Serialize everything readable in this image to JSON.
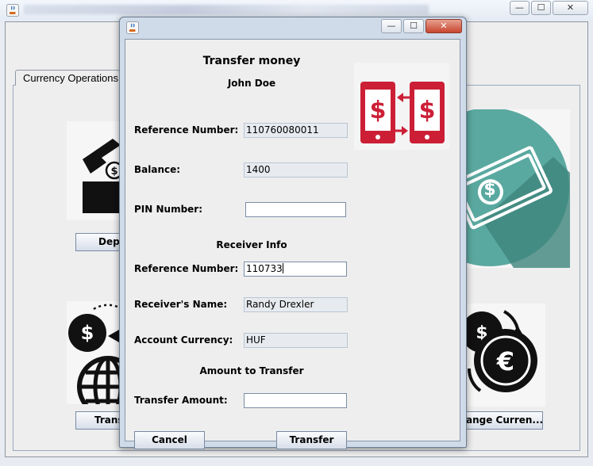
{
  "main_window": {
    "tab_label": "Currency Operations",
    "buttons": {
      "deposit": "Depo",
      "transfer": "Trans",
      "change_currency": "ange Curren..."
    },
    "window_controls": [
      "—",
      "☐",
      "✕"
    ]
  },
  "dialog": {
    "window_controls": [
      "—",
      "☐",
      "✕"
    ],
    "title": "Transfer money",
    "user_name": "John Doe",
    "fields": {
      "reference_number_label": "Reference Number:",
      "reference_number_value": "110760080011",
      "balance_label": "Balance:",
      "balance_value": "1400",
      "pin_label": "PIN Number:",
      "pin_value": ""
    },
    "receiver_section_title": "Receiver Info",
    "receiver": {
      "reference_number_label": "Reference Number:",
      "reference_number_value": "110733",
      "name_label": "Receiver's Name:",
      "name_value": "Randy Drexler",
      "currency_label": "Account Currency:",
      "currency_value": "HUF"
    },
    "amount_section_title": "Amount to Transfer",
    "transfer_amount_label": "Transfer Amount:",
    "transfer_amount_value": "",
    "cancel_label": "Cancel",
    "transfer_label": "Transfer"
  },
  "colors": {
    "phone_red": "#cc1f36",
    "teal_circle": "#5aa9a0",
    "teal_shadow": "#3d857c"
  }
}
